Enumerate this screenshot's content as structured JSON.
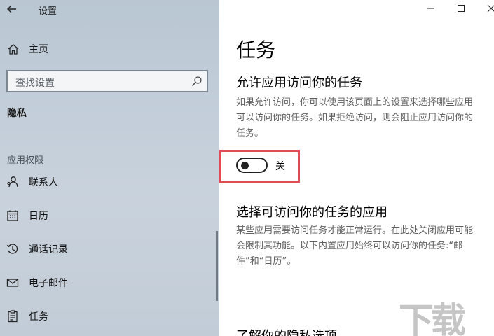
{
  "app": {
    "title": "设置"
  },
  "sidebar": {
    "home_label": "主页",
    "search_placeholder": "查找设置",
    "section": "隐私",
    "group_label": "应用权限",
    "items": [
      {
        "label": "联系人",
        "icon": "contacts-icon"
      },
      {
        "label": "日历",
        "icon": "calendar-icon"
      },
      {
        "label": "通话记录",
        "icon": "call-history-icon"
      },
      {
        "label": "电子邮件",
        "icon": "email-icon"
      },
      {
        "label": "任务",
        "icon": "tasks-icon"
      }
    ]
  },
  "content": {
    "title": "任务",
    "allow_heading": "允许应用访问你的任务",
    "allow_desc": "如果允许访问，你可以使用该页面上的设置来选择哪些应用可以访问你的任务。如果拒绝访问，则会阻止应用访问你的任务。",
    "toggle": {
      "state_label": "关",
      "on": false
    },
    "choose_heading": "选择可访问你的任务的应用",
    "choose_desc": "某些应用需要访问任务才能正常运行。在此处关闭应用可能会限制其功能。以下内置应用始终可以访问你的任务:“邮件”和“日历”。",
    "learn_heading": "了解你的隐私选项"
  },
  "watermark": "下载吧",
  "colors": {
    "highlight": "#e34b54",
    "sidebar_bg": "#c3ceda"
  }
}
